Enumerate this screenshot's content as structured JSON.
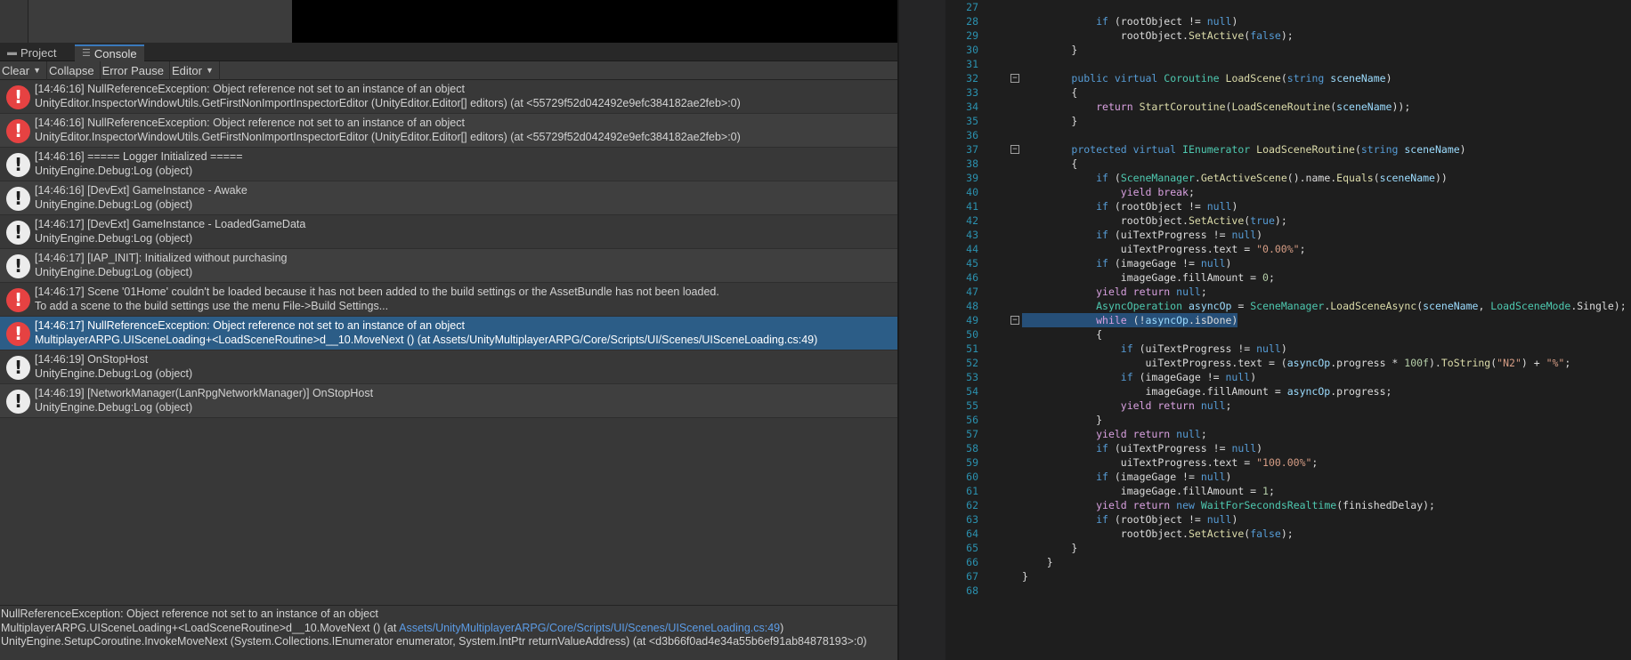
{
  "tabs": [
    {
      "label": "Project",
      "icon": "folder-icon"
    },
    {
      "label": "Console",
      "icon": "console-icon"
    }
  ],
  "toolbar": {
    "clear": "Clear",
    "collapse": "Collapse",
    "error_pause": "Error Pause",
    "editor": "Editor"
  },
  "logs": [
    {
      "type": "error",
      "line1": "[14:46:16] NullReferenceException: Object reference not set to an instance of an object",
      "line2": "UnityEditor.InspectorWindowUtils.GetFirstNonImportInspectorEditor (UnityEditor.Editor[] editors) (at <55729f52d042492e9efc384182ae2feb>:0)"
    },
    {
      "type": "error",
      "line1": "[14:46:16] NullReferenceException: Object reference not set to an instance of an object",
      "line2": "UnityEditor.InspectorWindowUtils.GetFirstNonImportInspectorEditor (UnityEditor.Editor[] editors) (at <55729f52d042492e9efc384182ae2feb>:0)"
    },
    {
      "type": "info",
      "line1": "[14:46:16] ===== Logger Initialized =====",
      "line2": "UnityEngine.Debug:Log (object)"
    },
    {
      "type": "info",
      "line1": "[14:46:16] [DevExt] GameInstance - Awake",
      "line2": "UnityEngine.Debug:Log (object)"
    },
    {
      "type": "info",
      "line1": "[14:46:17] [DevExt] GameInstance - LoadedGameData",
      "line2": "UnityEngine.Debug:Log (object)"
    },
    {
      "type": "info",
      "line1": "[14:46:17] [IAP_INIT]: Initialized without purchasing",
      "line2": "UnityEngine.Debug:Log (object)"
    },
    {
      "type": "error",
      "line1": "[14:46:17] Scene '01Home' couldn't be loaded because it has not been added to the build settings or the AssetBundle has not been loaded.",
      "line2": "To add a scene to the build settings use the menu File->Build Settings..."
    },
    {
      "type": "error",
      "selected": true,
      "line1": "[14:46:17] NullReferenceException: Object reference not set to an instance of an object",
      "line2": "MultiplayerARPG.UISceneLoading+<LoadSceneRoutine>d__10.MoveNext () (at Assets/UnityMultiplayerARPG/Core/Scripts/UI/Scenes/UISceneLoading.cs:49)"
    },
    {
      "type": "info",
      "line1": "[14:46:19] OnStopHost",
      "line2": "UnityEngine.Debug:Log (object)"
    },
    {
      "type": "info",
      "line1": "[14:46:19] [NetworkManager(LanRpgNetworkManager)] OnStopHost",
      "line2": "UnityEngine.Debug:Log (object)"
    }
  ],
  "detail": {
    "line1": "NullReferenceException: Object reference not set to an instance of an object",
    "line2_prefix": "MultiplayerARPG.UISceneLoading+<LoadSceneRoutine>d__10.MoveNext () (at ",
    "line2_link": "Assets/UnityMultiplayerARPG/Core/Scripts/UI/Scenes/UISceneLoading.cs:49",
    "line2_suffix": ")",
    "line3": "UnityEngine.SetupCoroutine.InvokeMoveNext (System.Collections.IEnumerator enumerator, System.IntPtr returnValueAddress) (at <d3b66f0ad4e34a55b6ef91ab84878193>:0)"
  },
  "code_lines": [
    {
      "n": "27",
      "html": ""
    },
    {
      "n": "28",
      "html": "            <span class=\"kw\">if</span> (rootObject != <span class=\"kw\">null</span>)"
    },
    {
      "n": "29",
      "html": "                rootObject.<span class=\"fn\">SetActive</span>(<span class=\"kw\">false</span>);"
    },
    {
      "n": "30",
      "html": "        }"
    },
    {
      "n": "31",
      "html": ""
    },
    {
      "n": "32",
      "fold": true,
      "html": "        <span class=\"kw\">public</span> <span class=\"kw\">virtual</span> <span class=\"ty\">Coroutine</span> <span class=\"fn\">LoadScene</span>(<span class=\"kw\">string</span> <span class=\"pr\">sceneName</span>)"
    },
    {
      "n": "33",
      "html": "        {"
    },
    {
      "n": "34",
      "html": "            <span class=\"cf\">return</span> <span class=\"fn\">StartCoroutine</span>(<span class=\"fn\">LoadSceneRoutine</span>(<span class=\"pr\">sceneName</span>));"
    },
    {
      "n": "35",
      "html": "        }"
    },
    {
      "n": "36",
      "html": ""
    },
    {
      "n": "37",
      "fold": true,
      "html": "        <span class=\"kw\">protected</span> <span class=\"kw\">virtual</span> <span class=\"ty\">IEnumerator</span> <span class=\"fn\">LoadSceneRoutine</span>(<span class=\"kw\">string</span> <span class=\"pr\">sceneName</span>)"
    },
    {
      "n": "38",
      "html": "        {"
    },
    {
      "n": "39",
      "html": "            <span class=\"kw\">if</span> (<span class=\"ty\">SceneManager</span>.<span class=\"fn\">GetActiveScene</span>().name.<span class=\"fn\">Equals</span>(<span class=\"pr\">sceneName</span>))"
    },
    {
      "n": "40",
      "html": "                <span class=\"cf\">yield</span> <span class=\"cf\">break</span>;"
    },
    {
      "n": "41",
      "html": "            <span class=\"kw\">if</span> (rootObject != <span class=\"kw\">null</span>)"
    },
    {
      "n": "42",
      "html": "                rootObject.<span class=\"fn\">SetActive</span>(<span class=\"kw\">true</span>);"
    },
    {
      "n": "43",
      "html": "            <span class=\"kw\">if</span> (uiTextProgress != <span class=\"kw\">null</span>)"
    },
    {
      "n": "44",
      "html": "                uiTextProgress.text = <span class=\"st\">\"0.00%\"</span>;"
    },
    {
      "n": "45",
      "html": "            <span class=\"kw\">if</span> (imageGage != <span class=\"kw\">null</span>)"
    },
    {
      "n": "46",
      "html": "                imageGage.fillAmount = <span class=\"nu\">0</span>;"
    },
    {
      "n": "47",
      "html": "            <span class=\"cf\">yield</span> <span class=\"cf\">return</span> <span class=\"kw\">null</span>;"
    },
    {
      "n": "48",
      "html": "            <span class=\"ty\">AsyncOperation</span> <span class=\"pr\">asyncOp</span> = <span class=\"ty\">SceneManager</span>.<span class=\"fn\">LoadSceneAsync</span>(<span class=\"pr\">sceneName</span>, <span class=\"ty\">LoadSceneMode</span>.Single);"
    },
    {
      "n": "49",
      "fold": true,
      "highlight": true,
      "html": "            <span class=\"cf\">while</span> (!<span class=\"pr\">asyncOp</span>.isDone)"
    },
    {
      "n": "50",
      "html": "            {"
    },
    {
      "n": "51",
      "html": "                <span class=\"kw\">if</span> (uiTextProgress != <span class=\"kw\">null</span>)"
    },
    {
      "n": "52",
      "html": "                    uiTextProgress.text = (<span class=\"pr\">asyncOp</span>.progress * <span class=\"nu\">100f</span>).<span class=\"fn\">ToString</span>(<span class=\"st\">\"N2\"</span>) + <span class=\"st\">\"%\"</span>;"
    },
    {
      "n": "53",
      "html": "                <span class=\"kw\">if</span> (imageGage != <span class=\"kw\">null</span>)"
    },
    {
      "n": "54",
      "html": "                    imageGage.fillAmount = <span class=\"pr\">asyncOp</span>.progress;"
    },
    {
      "n": "55",
      "html": "                <span class=\"cf\">yield</span> <span class=\"cf\">return</span> <span class=\"kw\">null</span>;"
    },
    {
      "n": "56",
      "html": "            }"
    },
    {
      "n": "57",
      "html": "            <span class=\"cf\">yield</span> <span class=\"cf\">return</span> <span class=\"kw\">null</span>;"
    },
    {
      "n": "58",
      "html": "            <span class=\"kw\">if</span> (uiTextProgress != <span class=\"kw\">null</span>)"
    },
    {
      "n": "59",
      "html": "                uiTextProgress.text = <span class=\"st\">\"100.00%\"</span>;"
    },
    {
      "n": "60",
      "html": "            <span class=\"kw\">if</span> (imageGage != <span class=\"kw\">null</span>)"
    },
    {
      "n": "61",
      "html": "                imageGage.fillAmount = <span class=\"nu\">1</span>;"
    },
    {
      "n": "62",
      "html": "            <span class=\"cf\">yield</span> <span class=\"cf\">return</span> <span class=\"kw\">new</span> <span class=\"ty\">WaitForSecondsRealtime</span>(finishedDelay);"
    },
    {
      "n": "63",
      "html": "            <span class=\"kw\">if</span> (rootObject != <span class=\"kw\">null</span>)"
    },
    {
      "n": "64",
      "html": "                rootObject.<span class=\"fn\">SetActive</span>(<span class=\"kw\">false</span>);"
    },
    {
      "n": "65",
      "html": "        }"
    },
    {
      "n": "66",
      "html": "    }"
    },
    {
      "n": "67",
      "html": "}"
    },
    {
      "n": "68",
      "html": ""
    }
  ]
}
